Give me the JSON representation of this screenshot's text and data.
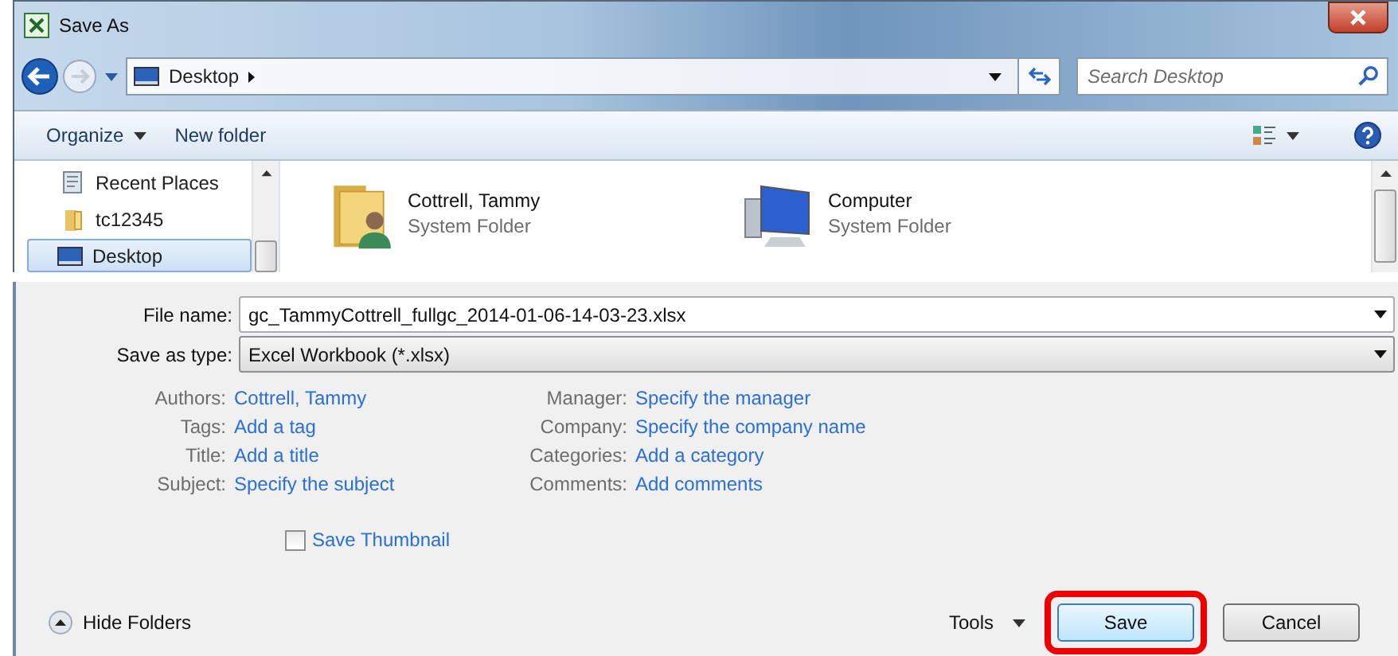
{
  "window": {
    "title": "Save As"
  },
  "address": {
    "path": "Desktop",
    "search_placeholder": "Search Desktop"
  },
  "toolbar": {
    "organize": "Organize",
    "new_folder": "New folder"
  },
  "sidebar": {
    "items": [
      {
        "label": "Recent Places",
        "kind": "recent",
        "selected": false
      },
      {
        "label": "tc12345",
        "kind": "folder",
        "selected": false
      },
      {
        "label": "Desktop",
        "kind": "desktop",
        "selected": true
      }
    ]
  },
  "files": [
    {
      "name": "Cottrell, Tammy",
      "type": "System Folder",
      "kind": "user"
    },
    {
      "name": "Computer",
      "type": "System Folder",
      "kind": "computer"
    }
  ],
  "file_name": {
    "label": "File name:",
    "value": "gc_TammyCottrell_fullgc_2014-01-06-14-03-23.xlsx"
  },
  "save_as_type": {
    "label": "Save as type:",
    "value": "Excel Workbook (*.xlsx)"
  },
  "properties_left": [
    {
      "label": "Authors:",
      "value": "Cottrell, Tammy"
    },
    {
      "label": "Tags:",
      "value": "Add a tag"
    },
    {
      "label": "Title:",
      "value": "Add a title"
    },
    {
      "label": "Subject:",
      "value": "Specify the subject"
    }
  ],
  "properties_right": [
    {
      "label": "Manager:",
      "value": "Specify the manager"
    },
    {
      "label": "Company:",
      "value": "Specify the company name"
    },
    {
      "label": "Categories:",
      "value": "Add a category"
    },
    {
      "label": "Comments:",
      "value": "Add comments"
    }
  ],
  "save_thumbnail": {
    "label": "Save Thumbnail",
    "checked": false
  },
  "footer": {
    "hide_folders": "Hide Folders",
    "tools": "Tools"
  },
  "buttons": [
    {
      "label": "Save",
      "highlighted": true
    },
    {
      "label": "Cancel",
      "highlighted": false
    }
  ]
}
